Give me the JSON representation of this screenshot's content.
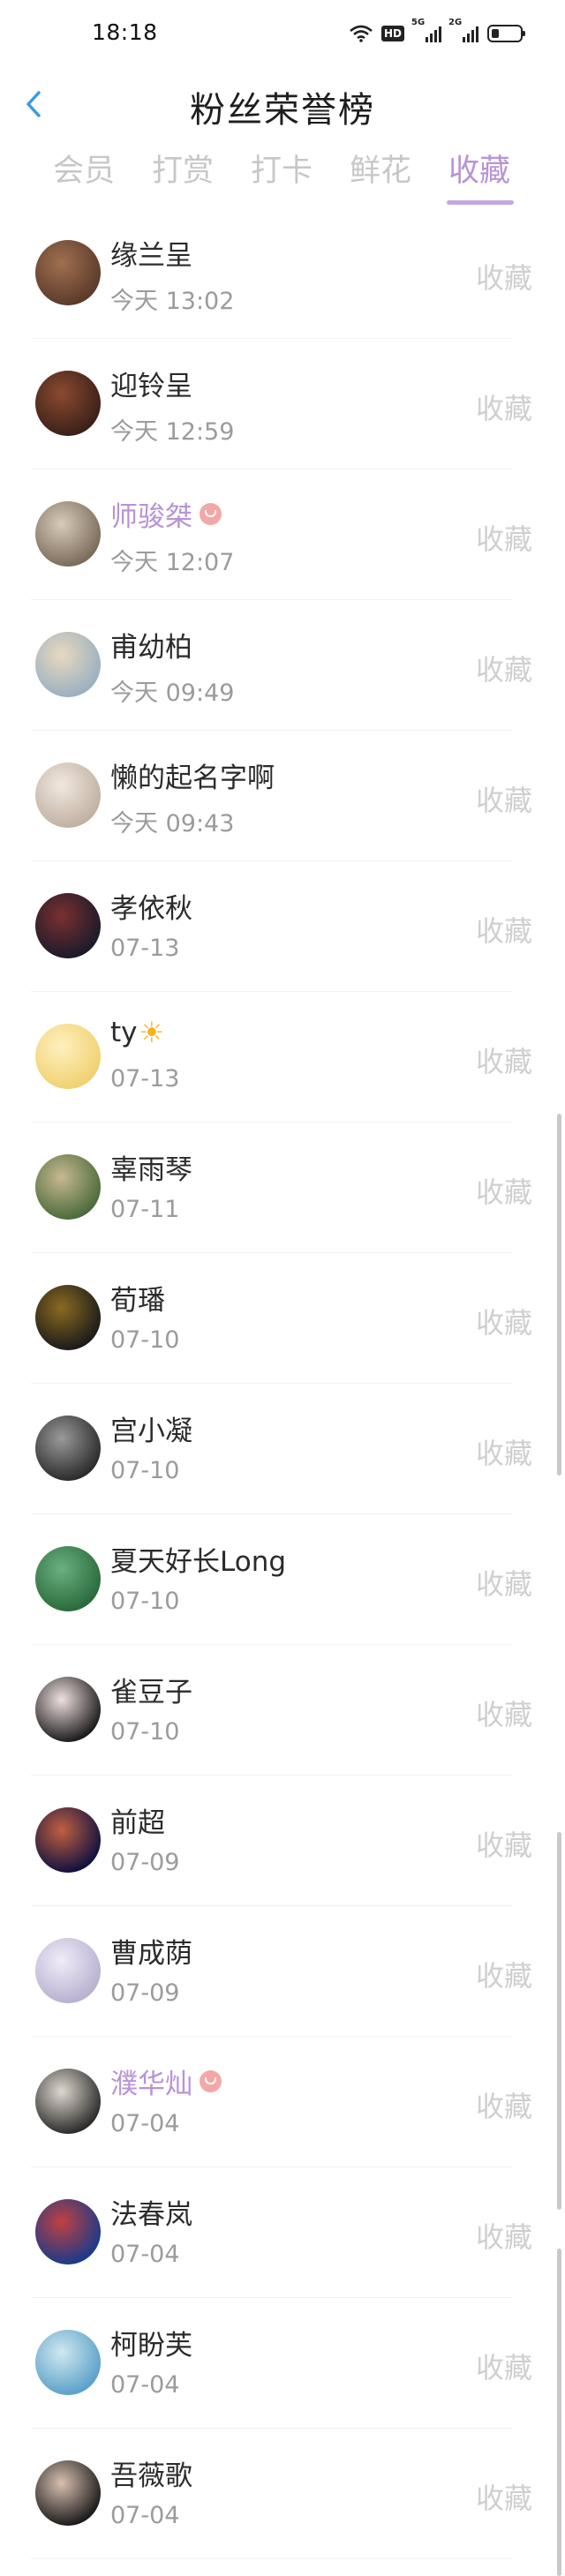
{
  "status_bar": {
    "time": "18:18",
    "hd_label": "HD",
    "sig1_label": "5G",
    "sig2_label": "2G",
    "battery_level": 0.25
  },
  "header": {
    "title": "粉丝荣誉榜",
    "back_icon": "chevron-left-icon"
  },
  "tabs": [
    {
      "label": "会员",
      "active": false
    },
    {
      "label": "打赏",
      "active": false
    },
    {
      "label": "打卡",
      "active": false
    },
    {
      "label": "鲜花",
      "active": false
    },
    {
      "label": "收藏",
      "active": true
    }
  ],
  "colors": {
    "accent": "#b893d6",
    "muted": "#c7c7c7",
    "action": "#cfcfcf"
  },
  "fans": [
    {
      "name": "缘兰呈",
      "time": "今天 13:02",
      "action": "收藏",
      "vip": false,
      "avatar": [
        "#5b3a2a",
        "#a07050"
      ]
    },
    {
      "name": "迎铃呈",
      "time": "今天 12:59",
      "action": "收藏",
      "vip": false,
      "avatar": [
        "#3a2018",
        "#8a4a30"
      ]
    },
    {
      "name": "师骏桀",
      "time": "今天 12:07",
      "action": "收藏",
      "vip": true,
      "avatar": [
        "#7a6a5a",
        "#d8cbb8"
      ]
    },
    {
      "name": "甫幼柏",
      "time": "今天 09:49",
      "action": "收藏",
      "vip": false,
      "avatar": [
        "#9ab0c0",
        "#e8d8c0"
      ]
    },
    {
      "name": "懒的起名字啊",
      "time": "今天 09:43",
      "action": "收藏",
      "vip": false,
      "avatar": [
        "#c0b0a0",
        "#f0e8e0"
      ]
    },
    {
      "name": "孝依秋",
      "time": "07-13",
      "action": "收藏",
      "vip": false,
      "avatar": [
        "#1a1a2a",
        "#7a3030"
      ]
    },
    {
      "name": "ty",
      "time": "07-13",
      "action": "收藏",
      "vip": false,
      "sun": true,
      "avatar": [
        "#f0d070",
        "#fff0c0"
      ]
    },
    {
      "name": "辜雨琴",
      "time": "07-11",
      "action": "收藏",
      "vip": false,
      "avatar": [
        "#4a6a3a",
        "#c8b890"
      ]
    },
    {
      "name": "荀璠",
      "time": "07-10",
      "action": "收藏",
      "vip": false,
      "avatar": [
        "#1a1a1a",
        "#8a6a20"
      ]
    },
    {
      "name": "宫小凝",
      "time": "07-10",
      "action": "收藏",
      "vip": false,
      "avatar": [
        "#2a2a2a",
        "#9a9a9a"
      ]
    },
    {
      "name": "夏天好长Long",
      "time": "07-10",
      "action": "收藏",
      "vip": false,
      "avatar": [
        "#2a6a3a",
        "#6ab080"
      ]
    },
    {
      "name": "雀豆子",
      "time": "07-10",
      "action": "收藏",
      "vip": false,
      "avatar": [
        "#1a1a1a",
        "#f0e0e0"
      ]
    },
    {
      "name": "前超",
      "time": "07-09",
      "action": "收藏",
      "vip": false,
      "avatar": [
        "#101040",
        "#c06040"
      ]
    },
    {
      "name": "曹成荫",
      "time": "07-09",
      "action": "收藏",
      "vip": false,
      "avatar": [
        "#b8b0d0",
        "#f0ecf8"
      ]
    },
    {
      "name": "濮华灿",
      "time": "07-04",
      "action": "收藏",
      "vip": true,
      "avatar": [
        "#2a2a2a",
        "#e0d8d0"
      ]
    },
    {
      "name": "法春岚",
      "time": "07-04",
      "action": "收藏",
      "vip": false,
      "avatar": [
        "#1a3a8a",
        "#c04040"
      ]
    },
    {
      "name": "柯盼芙",
      "time": "07-04",
      "action": "收藏",
      "vip": false,
      "avatar": [
        "#5aa0c8",
        "#d0e8f0"
      ]
    },
    {
      "name": "吾薇歌",
      "time": "07-04",
      "action": "收藏",
      "vip": false,
      "avatar": [
        "#1a1a1a",
        "#d8c0b0"
      ]
    }
  ]
}
